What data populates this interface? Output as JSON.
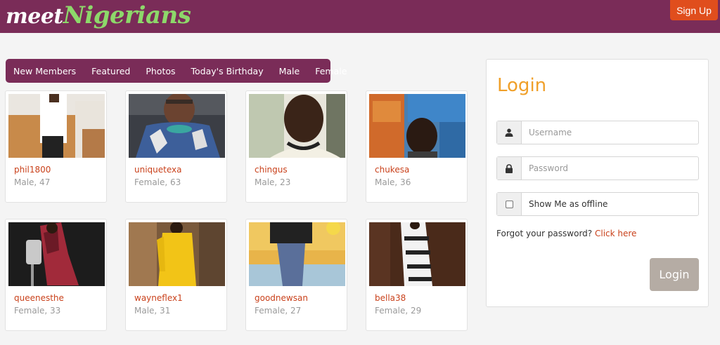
{
  "header": {
    "logo_meet": "meet",
    "logo_nigerians": "Nigerians",
    "signup_label": "Sign Up",
    "bar_color": "#7a2c58",
    "signup_color": "#e04e1d"
  },
  "tabs": [
    {
      "label": "New Members"
    },
    {
      "label": "Featured"
    },
    {
      "label": "Photos"
    },
    {
      "label": "Today's Birthday"
    },
    {
      "label": "Male"
    },
    {
      "label": "Female"
    }
  ],
  "members": [
    {
      "username": "phil1800",
      "info": "Male, 47"
    },
    {
      "username": "uniquetexa",
      "info": "Female, 63"
    },
    {
      "username": "chingus",
      "info": "Male, 23"
    },
    {
      "username": "chukesa",
      "info": "Male, 36"
    },
    {
      "username": "queenesthe",
      "info": "Female, 33"
    },
    {
      "username": "wayneflex1",
      "info": "Male, 31"
    },
    {
      "username": "goodnewsan",
      "info": "Female, 27"
    },
    {
      "username": "bella38",
      "info": "Female, 29"
    }
  ],
  "login": {
    "title": "Login",
    "username_placeholder": "Username",
    "password_placeholder": "Password",
    "offline_label": "Show Me as offline",
    "forgot_text": "Forgot your password?",
    "forgot_link": "Click here",
    "button_label": "Login",
    "title_color": "#f0a02a",
    "button_color": "#b5aca4"
  },
  "icons": {
    "username": "user-icon",
    "password": "lock-icon"
  }
}
